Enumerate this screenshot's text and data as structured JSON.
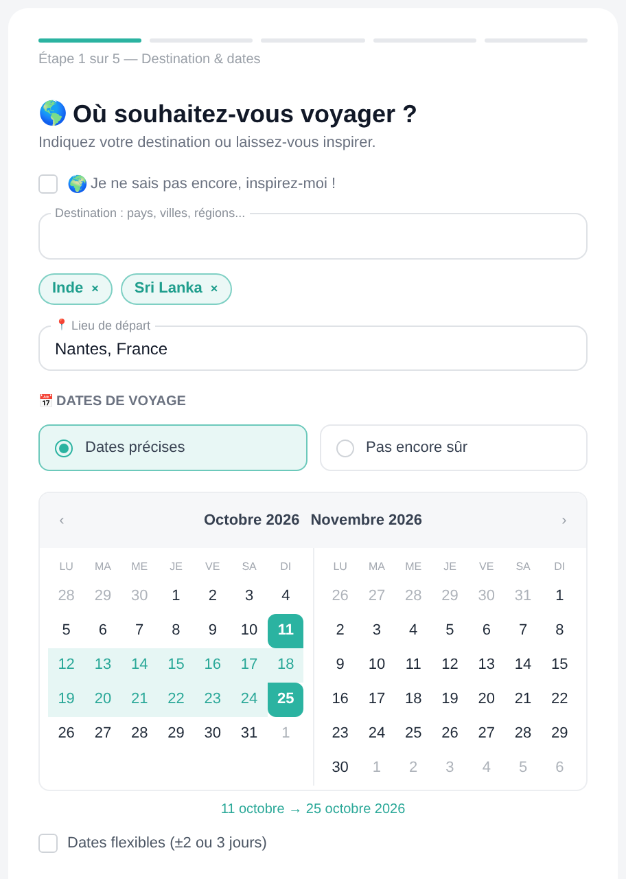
{
  "progress": {
    "steps": [
      {
        "active": true
      },
      {
        "active": false
      },
      {
        "active": false
      },
      {
        "active": false
      },
      {
        "active": false
      }
    ],
    "caption": "Étape 1 sur 5 — Destination & dates"
  },
  "heading": {
    "emoji": "🌎",
    "title": "Où souhaitez-vous voyager ?",
    "subtitle": "Indiquez votre destination ou laissez-vous inspirer."
  },
  "inspire": {
    "checked": false,
    "emoji": "🌍",
    "label": "Je ne sais pas encore, inspirez-moi !"
  },
  "destination": {
    "label": "Destination : pays, villes, régions..."
  },
  "chips": [
    {
      "label": "Inde",
      "remove": "×"
    },
    {
      "label": "Sri Lanka",
      "remove": "×"
    }
  ],
  "departure": {
    "emoji": "📍",
    "label": "Lieu de départ",
    "value": "Nantes, France"
  },
  "dates_section": {
    "emoji": "📅",
    "label": "DATES DE VOYAGE"
  },
  "date_modes": [
    {
      "label": "Dates précises",
      "selected": true
    },
    {
      "label": "Pas encore sûr",
      "selected": false
    }
  ],
  "calendar": {
    "prev": "‹",
    "next": "›",
    "months": [
      {
        "title": "Octobre 2026",
        "weekdays": [
          "LU",
          "MA",
          "ME",
          "JE",
          "VE",
          "SA",
          "DI"
        ],
        "weeks": [
          [
            {
              "label": "28",
              "kind": "outside"
            },
            {
              "label": "29",
              "kind": "outside"
            },
            {
              "label": "30",
              "kind": "outside"
            },
            {
              "label": "1",
              "kind": "day"
            },
            {
              "label": "2",
              "kind": "day"
            },
            {
              "label": "3",
              "kind": "day"
            },
            {
              "label": "4",
              "kind": "day"
            }
          ],
          [
            {
              "label": "5",
              "kind": "day"
            },
            {
              "label": "6",
              "kind": "day"
            },
            {
              "label": "7",
              "kind": "day"
            },
            {
              "label": "8",
              "kind": "day"
            },
            {
              "label": "9",
              "kind": "day"
            },
            {
              "label": "10",
              "kind": "day"
            },
            {
              "label": "11",
              "kind": "start"
            }
          ],
          [
            {
              "label": "12",
              "kind": "range"
            },
            {
              "label": "13",
              "kind": "range"
            },
            {
              "label": "14",
              "kind": "range"
            },
            {
              "label": "15",
              "kind": "range"
            },
            {
              "label": "16",
              "kind": "range"
            },
            {
              "label": "17",
              "kind": "range"
            },
            {
              "label": "18",
              "kind": "range"
            }
          ],
          [
            {
              "label": "19",
              "kind": "range"
            },
            {
              "label": "20",
              "kind": "range"
            },
            {
              "label": "21",
              "kind": "range"
            },
            {
              "label": "22",
              "kind": "range"
            },
            {
              "label": "23",
              "kind": "range"
            },
            {
              "label": "24",
              "kind": "range"
            },
            {
              "label": "25",
              "kind": "end"
            }
          ],
          [
            {
              "label": "26",
              "kind": "day"
            },
            {
              "label": "27",
              "kind": "day"
            },
            {
              "label": "28",
              "kind": "day"
            },
            {
              "label": "29",
              "kind": "day"
            },
            {
              "label": "30",
              "kind": "day"
            },
            {
              "label": "31",
              "kind": "day"
            },
            {
              "label": "1",
              "kind": "outside"
            }
          ]
        ]
      },
      {
        "title": "Novembre 2026",
        "weekdays": [
          "LU",
          "MA",
          "ME",
          "JE",
          "VE",
          "SA",
          "DI"
        ],
        "weeks": [
          [
            {
              "label": "26",
              "kind": "outside"
            },
            {
              "label": "27",
              "kind": "outside"
            },
            {
              "label": "28",
              "kind": "outside"
            },
            {
              "label": "29",
              "kind": "outside"
            },
            {
              "label": "30",
              "kind": "outside"
            },
            {
              "label": "31",
              "kind": "outside"
            },
            {
              "label": "1",
              "kind": "day"
            }
          ],
          [
            {
              "label": "2",
              "kind": "day"
            },
            {
              "label": "3",
              "kind": "day"
            },
            {
              "label": "4",
              "kind": "day"
            },
            {
              "label": "5",
              "kind": "day"
            },
            {
              "label": "6",
              "kind": "day"
            },
            {
              "label": "7",
              "kind": "day"
            },
            {
              "label": "8",
              "kind": "day"
            }
          ],
          [
            {
              "label": "9",
              "kind": "day"
            },
            {
              "label": "10",
              "kind": "day"
            },
            {
              "label": "11",
              "kind": "day"
            },
            {
              "label": "12",
              "kind": "day"
            },
            {
              "label": "13",
              "kind": "day"
            },
            {
              "label": "14",
              "kind": "day"
            },
            {
              "label": "15",
              "kind": "day"
            }
          ],
          [
            {
              "label": "16",
              "kind": "day"
            },
            {
              "label": "17",
              "kind": "day"
            },
            {
              "label": "18",
              "kind": "day"
            },
            {
              "label": "19",
              "kind": "day"
            },
            {
              "label": "20",
              "kind": "day"
            },
            {
              "label": "21",
              "kind": "day"
            },
            {
              "label": "22",
              "kind": "day"
            }
          ],
          [
            {
              "label": "23",
              "kind": "day"
            },
            {
              "label": "24",
              "kind": "day"
            },
            {
              "label": "25",
              "kind": "day"
            },
            {
              "label": "26",
              "kind": "day"
            },
            {
              "label": "27",
              "kind": "day"
            },
            {
              "label": "28",
              "kind": "day"
            },
            {
              "label": "29",
              "kind": "day"
            }
          ],
          [
            {
              "label": "30",
              "kind": "day"
            },
            {
              "label": "1",
              "kind": "outside"
            },
            {
              "label": "2",
              "kind": "outside"
            },
            {
              "label": "3",
              "kind": "outside"
            },
            {
              "label": "4",
              "kind": "outside"
            },
            {
              "label": "5",
              "kind": "outside"
            },
            {
              "label": "6",
              "kind": "outside"
            }
          ]
        ]
      }
    ]
  },
  "range_summary": "11 octobre → 25 octobre 2026",
  "flexible": {
    "checked": false,
    "label": "Dates flexibles (±2 ou 3 jours)"
  }
}
